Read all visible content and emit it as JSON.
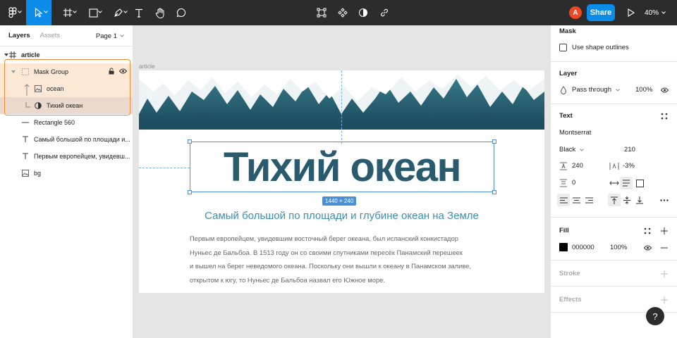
{
  "toolbar": {
    "tools": [
      "main-menu",
      "move",
      "frame",
      "shape",
      "pen",
      "text",
      "hand",
      "comment"
    ],
    "center_tools": [
      "select-matching",
      "component",
      "mask",
      "link"
    ],
    "avatar_initial": "A",
    "share_label": "Share",
    "zoom_label": "40%",
    "accent": "#0c8ce9"
  },
  "layers_panel": {
    "tabs": [
      "Layers",
      "Assets"
    ],
    "active_tab": "Layers",
    "page_label": "Page 1",
    "items": [
      {
        "name": "article",
        "icon": "frame-icon"
      },
      {
        "name": "Mask Group",
        "icon": "group-icon",
        "selected": true
      },
      {
        "name": "ocean",
        "icon": "image-icon"
      },
      {
        "name": "Тихий океан",
        "icon": "mask-icon"
      },
      {
        "name": "Rectangle 560",
        "icon": "line-icon"
      },
      {
        "name": "Самый большой по площади и...",
        "icon": "text-icon"
      },
      {
        "name": "Первым европейцем, увидевш...",
        "icon": "text-icon"
      },
      {
        "name": "bg",
        "icon": "image-icon"
      }
    ],
    "highlight_color": "#f08c3c"
  },
  "canvas": {
    "frame_name": "article",
    "title": "Тихий океан",
    "size_badge": "1440 × 240",
    "subtitle": "Самый большой по площади и глубине океан на Земле",
    "paragraph": [
      "Первым европейцем, увидевшим восточный берег океана, был испанский конкистадор",
      "Нуньес де Бальбоа. В 1513 году он со своими спутниками пересёк Панамский перешеек",
      "и вышел на берег неведомого океана. Поскольку они вышли к океану в Панамском заливе,",
      "открытом к югу, то Нуньес де Бальбоа назвал его Южное море."
    ]
  },
  "properties": {
    "mask": {
      "title": "Mask",
      "checkbox_label": "Use shape outlines"
    },
    "layer": {
      "title": "Layer",
      "blend": "Pass through",
      "opacity": "100%"
    },
    "text": {
      "title": "Text",
      "font_family": "Montserrat",
      "font_weight": "Black",
      "font_size": "210",
      "line_height": "240",
      "letter_spacing": "-3%",
      "paragraph_spacing": "0"
    },
    "fill": {
      "title": "Fill",
      "hex": "000000",
      "opacity": "100%"
    },
    "stroke": {
      "title": "Stroke"
    },
    "effects": {
      "title": "Effects"
    }
  },
  "help": {
    "label": "?"
  }
}
